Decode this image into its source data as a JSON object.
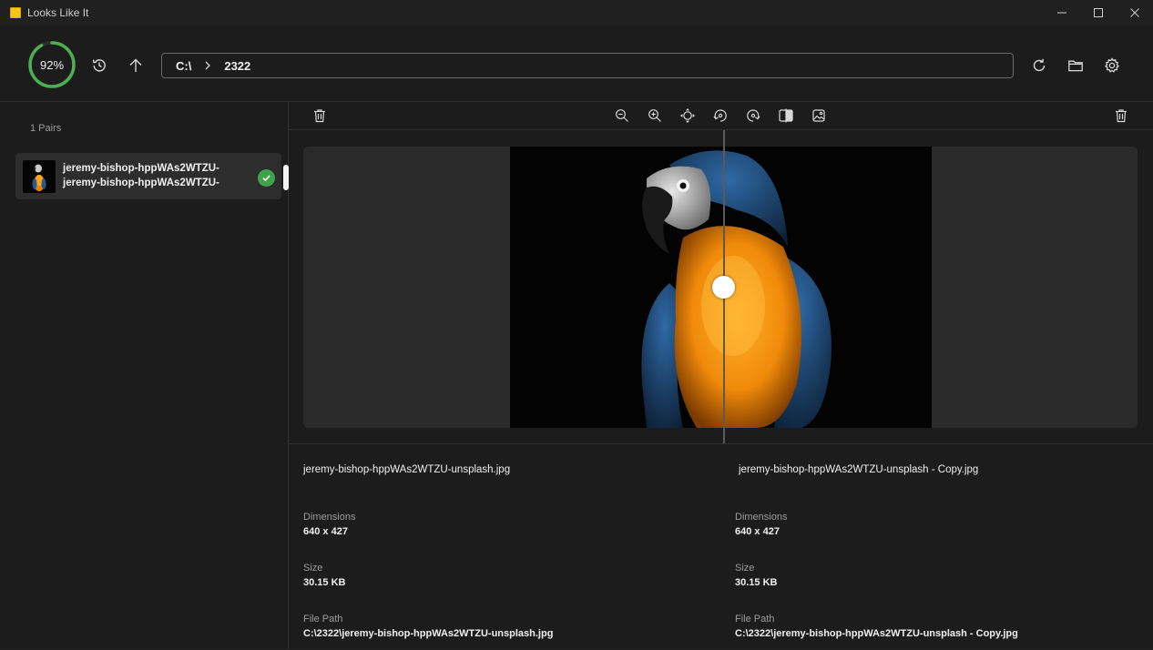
{
  "window": {
    "title": "Looks Like It",
    "controls": [
      "minimize-icon",
      "maximize-icon",
      "close-icon"
    ]
  },
  "toolbar": {
    "progress_text": "92%",
    "progress_value": 0.92,
    "accent_color": "#4caf50",
    "path": {
      "root": "C:\\",
      "folder": "2322"
    }
  },
  "sidebar": {
    "pairs_label": "1 Pairs",
    "pairs": [
      {
        "name_a": "jeremy-bishop-hppWAs2WTZU-",
        "name_b": "jeremy-bishop-hppWAs2WTZU-",
        "status": "check-icon"
      }
    ]
  },
  "image_toolbar": {
    "icons": [
      "delete-icon",
      "zoom-out-icon",
      "zoom-in-icon",
      "fit-icon",
      "rotate-left-icon",
      "rotate-right-icon",
      "compare-split-icon",
      "image-icon",
      "delete-icon"
    ]
  },
  "details": {
    "left": {
      "filename": "jeremy-bishop-hppWAs2WTZU-unsplash.jpg",
      "dimensions_label": "Dimensions",
      "dimensions_value": "640 x 427",
      "size_label": "Size",
      "size_value": "30.15 KB",
      "path_label": "File Path",
      "path_value": "C:\\2322\\jeremy-bishop-hppWAs2WTZU-unsplash.jpg"
    },
    "right": {
      "filename": "jeremy-bishop-hppWAs2WTZU-unsplash - Copy.jpg",
      "dimensions_label": "Dimensions",
      "dimensions_value": "640 x 427",
      "size_label": "Size",
      "size_value": "30.15 KB",
      "path_label": "File Path",
      "path_value": "C:\\2322\\jeremy-bishop-hppWAs2WTZU-unsplash - Copy.jpg"
    }
  }
}
